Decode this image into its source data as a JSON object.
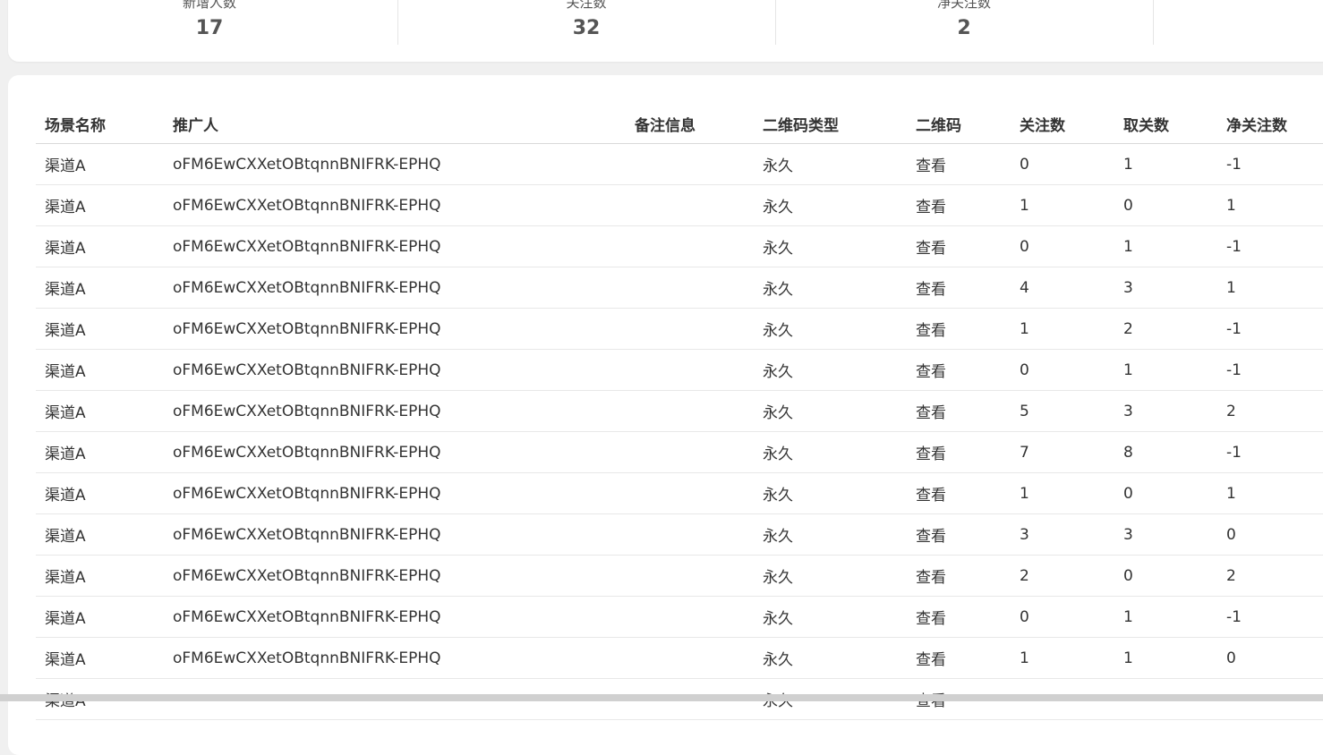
{
  "stats": [
    {
      "label": "新增人数",
      "value": "17"
    },
    {
      "label": "关注数",
      "value": "32"
    },
    {
      "label": "净关注数",
      "value": "2"
    }
  ],
  "table": {
    "columns": [
      "场景名称",
      "推广人",
      "备注信息",
      "二维码类型",
      "二维码",
      "关注数",
      "取关数",
      "净关注数"
    ],
    "rows": [
      {
        "scene": "渠道A",
        "promoter": "oFM6EwCXXetOBtqnnBNIFRK-EPHQ",
        "remark": "",
        "qr_type": "永久",
        "qr_action": "查看",
        "follow": "0",
        "unfollow": "1",
        "net": "-1"
      },
      {
        "scene": "渠道A",
        "promoter": "oFM6EwCXXetOBtqnnBNIFRK-EPHQ",
        "remark": "",
        "qr_type": "永久",
        "qr_action": "查看",
        "follow": "1",
        "unfollow": "0",
        "net": "1"
      },
      {
        "scene": "渠道A",
        "promoter": "oFM6EwCXXetOBtqnnBNIFRK-EPHQ",
        "remark": "",
        "qr_type": "永久",
        "qr_action": "查看",
        "follow": "0",
        "unfollow": "1",
        "net": "-1"
      },
      {
        "scene": "渠道A",
        "promoter": "oFM6EwCXXetOBtqnnBNIFRK-EPHQ",
        "remark": "",
        "qr_type": "永久",
        "qr_action": "查看",
        "follow": "4",
        "unfollow": "3",
        "net": "1"
      },
      {
        "scene": "渠道A",
        "promoter": "oFM6EwCXXetOBtqnnBNIFRK-EPHQ",
        "remark": "",
        "qr_type": "永久",
        "qr_action": "查看",
        "follow": "1",
        "unfollow": "2",
        "net": "-1"
      },
      {
        "scene": "渠道A",
        "promoter": "oFM6EwCXXetOBtqnnBNIFRK-EPHQ",
        "remark": "",
        "qr_type": "永久",
        "qr_action": "查看",
        "follow": "0",
        "unfollow": "1",
        "net": "-1"
      },
      {
        "scene": "渠道A",
        "promoter": "oFM6EwCXXetOBtqnnBNIFRK-EPHQ",
        "remark": "",
        "qr_type": "永久",
        "qr_action": "查看",
        "follow": "5",
        "unfollow": "3",
        "net": "2"
      },
      {
        "scene": "渠道A",
        "promoter": "oFM6EwCXXetOBtqnnBNIFRK-EPHQ",
        "remark": "",
        "qr_type": "永久",
        "qr_action": "查看",
        "follow": "7",
        "unfollow": "8",
        "net": "-1"
      },
      {
        "scene": "渠道A",
        "promoter": "oFM6EwCXXetOBtqnnBNIFRK-EPHQ",
        "remark": "",
        "qr_type": "永久",
        "qr_action": "查看",
        "follow": "1",
        "unfollow": "0",
        "net": "1"
      },
      {
        "scene": "渠道A",
        "promoter": "oFM6EwCXXetOBtqnnBNIFRK-EPHQ",
        "remark": "",
        "qr_type": "永久",
        "qr_action": "查看",
        "follow": "3",
        "unfollow": "3",
        "net": "0"
      },
      {
        "scene": "渠道A",
        "promoter": "oFM6EwCXXetOBtqnnBNIFRK-EPHQ",
        "remark": "",
        "qr_type": "永久",
        "qr_action": "查看",
        "follow": "2",
        "unfollow": "0",
        "net": "2"
      },
      {
        "scene": "渠道A",
        "promoter": "oFM6EwCXXetOBtqnnBNIFRK-EPHQ",
        "remark": "",
        "qr_type": "永久",
        "qr_action": "查看",
        "follow": "0",
        "unfollow": "1",
        "net": "-1"
      },
      {
        "scene": "渠道A",
        "promoter": "oFM6EwCXXetOBtqnnBNIFRK-EPHQ",
        "remark": "",
        "qr_type": "永久",
        "qr_action": "查看",
        "follow": "1",
        "unfollow": "1",
        "net": "0"
      },
      {
        "scene": "渠道A",
        "promoter": "",
        "remark": "",
        "qr_type": "永久",
        "qr_action": "查看",
        "follow": "",
        "unfollow": "",
        "net": ""
      }
    ]
  }
}
